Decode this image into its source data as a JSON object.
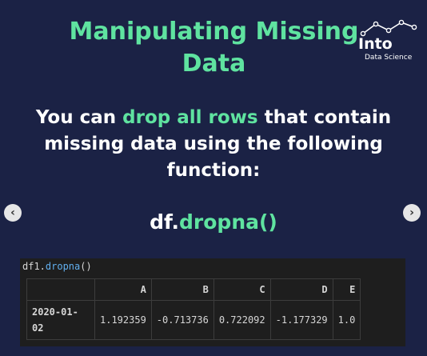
{
  "slide": {
    "title": "Manipulating Missing Data",
    "logo": {
      "word": "Into",
      "subtitle": "Data Science"
    },
    "body": {
      "pre": "You can ",
      "highlight": "drop all rows",
      "post": " that contain missing data using the following function:"
    },
    "code": {
      "object": "df.",
      "method": "dropna()"
    },
    "nav": {
      "prev_icon": "chevron-left-icon",
      "next_icon": "chevron-right-icon"
    }
  },
  "notebook": {
    "cell_code": {
      "object": "df1.",
      "method": "dropna",
      "args": "()"
    },
    "table": {
      "columns": [
        "",
        "A",
        "B",
        "C",
        "D",
        "E"
      ],
      "rows": [
        {
          "index": "2020-01-02",
          "values": [
            "1.192359",
            "-0.713736",
            "0.722092",
            "-1.177329",
            "1.0"
          ]
        }
      ]
    }
  },
  "colors": {
    "background": "#1b2245",
    "accent": "#5fe3a0",
    "text": "#ffffff",
    "notebook_bg": "#1e1e1e"
  }
}
